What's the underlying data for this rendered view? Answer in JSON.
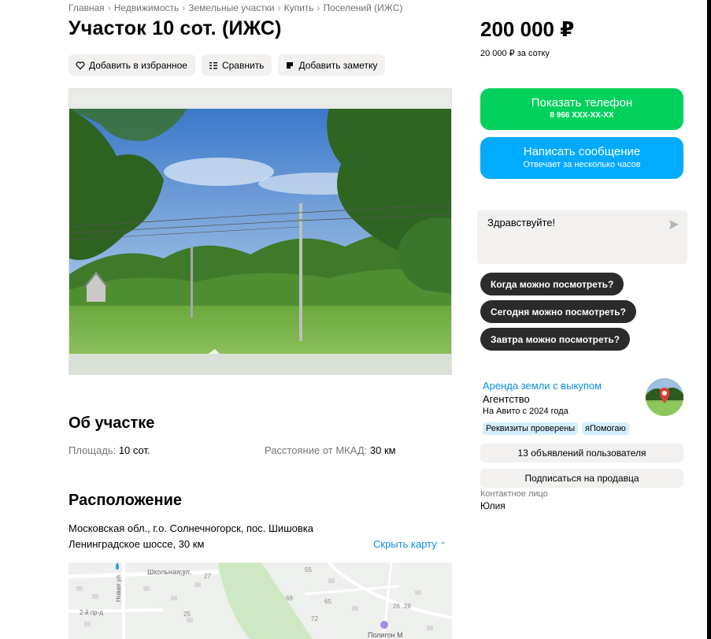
{
  "breadcrumb": [
    "Главная",
    "Недвижимость",
    "Земельные участки",
    "Купить",
    "Поселений (ИЖС)"
  ],
  "title": "Участок 10 сот. (ИЖС)",
  "actions": {
    "favorite": "Добавить в избранное",
    "compare": "Сравнить",
    "note": "Добавить заметку"
  },
  "about": {
    "title": "Об участке",
    "area_label": "Площадь:",
    "area_value": "10 сот.",
    "mkad_label": "Расстояние от МКАД:",
    "mkad_value": "30 км"
  },
  "location": {
    "title": "Расположение",
    "address": "Московская обл., г.о. Солнечногорск, пос. Шишовка",
    "highway": "Ленинградское шоссе, 30 км",
    "hide_map": "Скрыть карту",
    "map_labels": {
      "street1": "Школьная ул.",
      "street2": "Новая ул.",
      "street3": "2-й пр-д",
      "poi": "Полигон М",
      "n1": "57",
      "n2": "55",
      "n3": "27",
      "n4": "69",
      "n5": "65",
      "n6": "72",
      "n7": "28",
      "n8": "26",
      "n9": "25"
    }
  },
  "price": {
    "value": "200 000 ₽",
    "per_unit": "20 000 ₽ за сотку"
  },
  "contact_buttons": {
    "phone_label": "Показать телефон",
    "phone_sub": "8 966 XXX-XX-XX",
    "message_label": "Написать сообщение",
    "message_sub": "Отвечает за несколько часов"
  },
  "chat": {
    "input_value": "Здравствуйте!",
    "quick_replies": [
      "Когда можно посмотреть?",
      "Сегодня можно посмотреть?",
      "Завтра можно посмотреть?"
    ]
  },
  "seller": {
    "name": "Аренда земли с выкупом",
    "type": "Агентство",
    "since": "На Авито с 2024 года",
    "badges": [
      "Реквизиты проверены",
      "яПомогаю"
    ],
    "listings": "13 объявлений пользователя",
    "subscribe": "Подписаться на продавца",
    "contact_label": "Контактное лицо",
    "contact_name": "Юлия"
  },
  "colors": {
    "green": "#02d15c",
    "blue": "#00aaff",
    "link": "#0a8ee0"
  }
}
